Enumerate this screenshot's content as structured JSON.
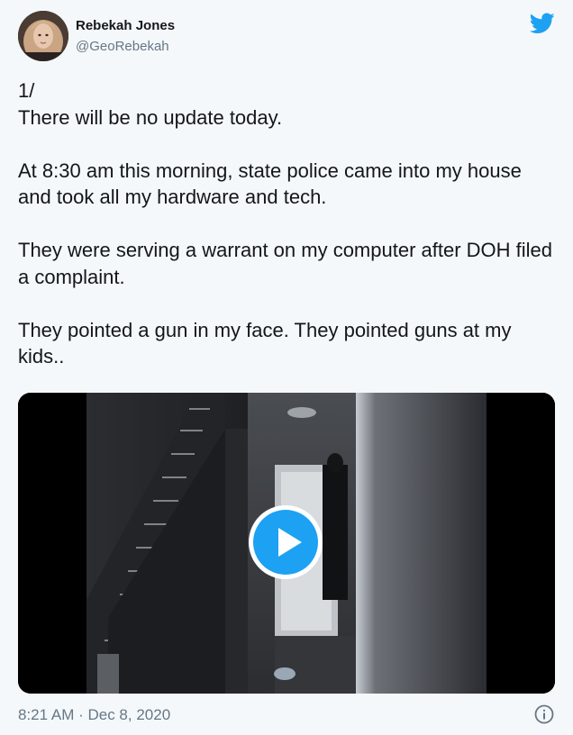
{
  "author": {
    "name": "Rebekah Jones",
    "handle": "@GeoRebekah"
  },
  "tweet": {
    "lines": [
      "1/",
      "There will be no update today.",
      "At 8:30 am this morning, state police came into my house and took all my hardware and tech.",
      "They were serving a warrant on my computer after DOH filed a complaint.",
      "They pointed a gun in my face.  They pointed guns at my kids.."
    ],
    "timestamp": "8:21 AM · Dec 8, 2020"
  },
  "media": {
    "type": "video",
    "play_icon": "play-icon"
  },
  "icons": {
    "brand": "twitter-bird-icon",
    "info": "info-icon"
  },
  "colors": {
    "brand": "#1da1f2",
    "text": "#14171a",
    "secondary_text": "#657786",
    "background": "#f5f8fa"
  }
}
